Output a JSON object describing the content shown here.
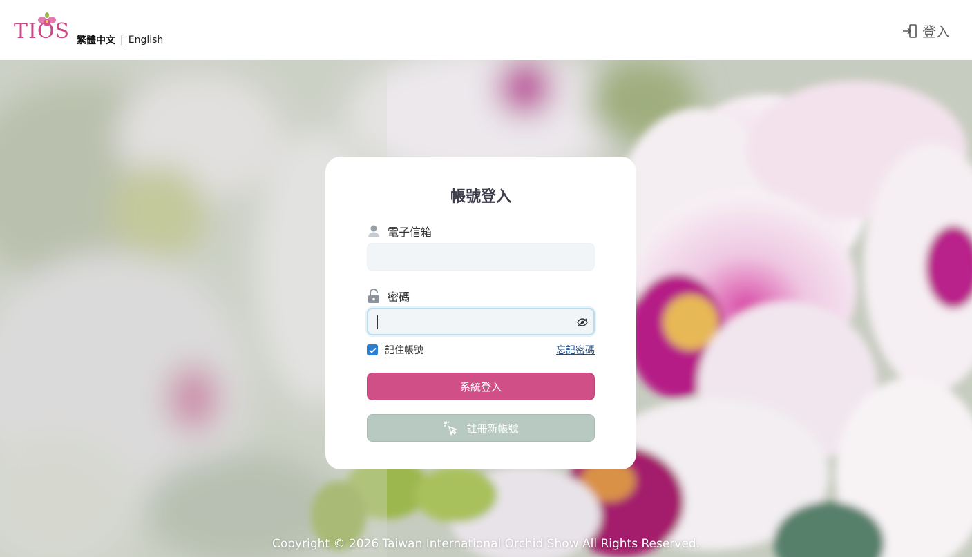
{
  "header": {
    "logo_text": "TIOS",
    "lang_zh": "繁體中文",
    "lang_sep": "|",
    "lang_en": "English",
    "login_label": "登入"
  },
  "card": {
    "title": "帳號登入",
    "email_label": "電子信箱",
    "email_value": "",
    "password_label": "密碼",
    "password_value": "",
    "remember_label": "記住帳號",
    "remember_checked": true,
    "forgot_label": "忘記密碼",
    "login_button": "系統登入",
    "register_button": "註冊新帳號"
  },
  "footer": {
    "copyright": "Copyright © 2026 Taiwan International Orchid Show All Rights Reserved."
  },
  "colors": {
    "brand_pink": "#d04f87",
    "register_green": "#b7c9c0",
    "checkbox_blue": "#2b7fd2",
    "link_blue": "#1f4f8a"
  },
  "icons": [
    "orchid-logo-icon",
    "login-door-icon",
    "user-icon",
    "lock-icon",
    "eye-icon",
    "checkmark-icon",
    "click-pointer-icon"
  ]
}
